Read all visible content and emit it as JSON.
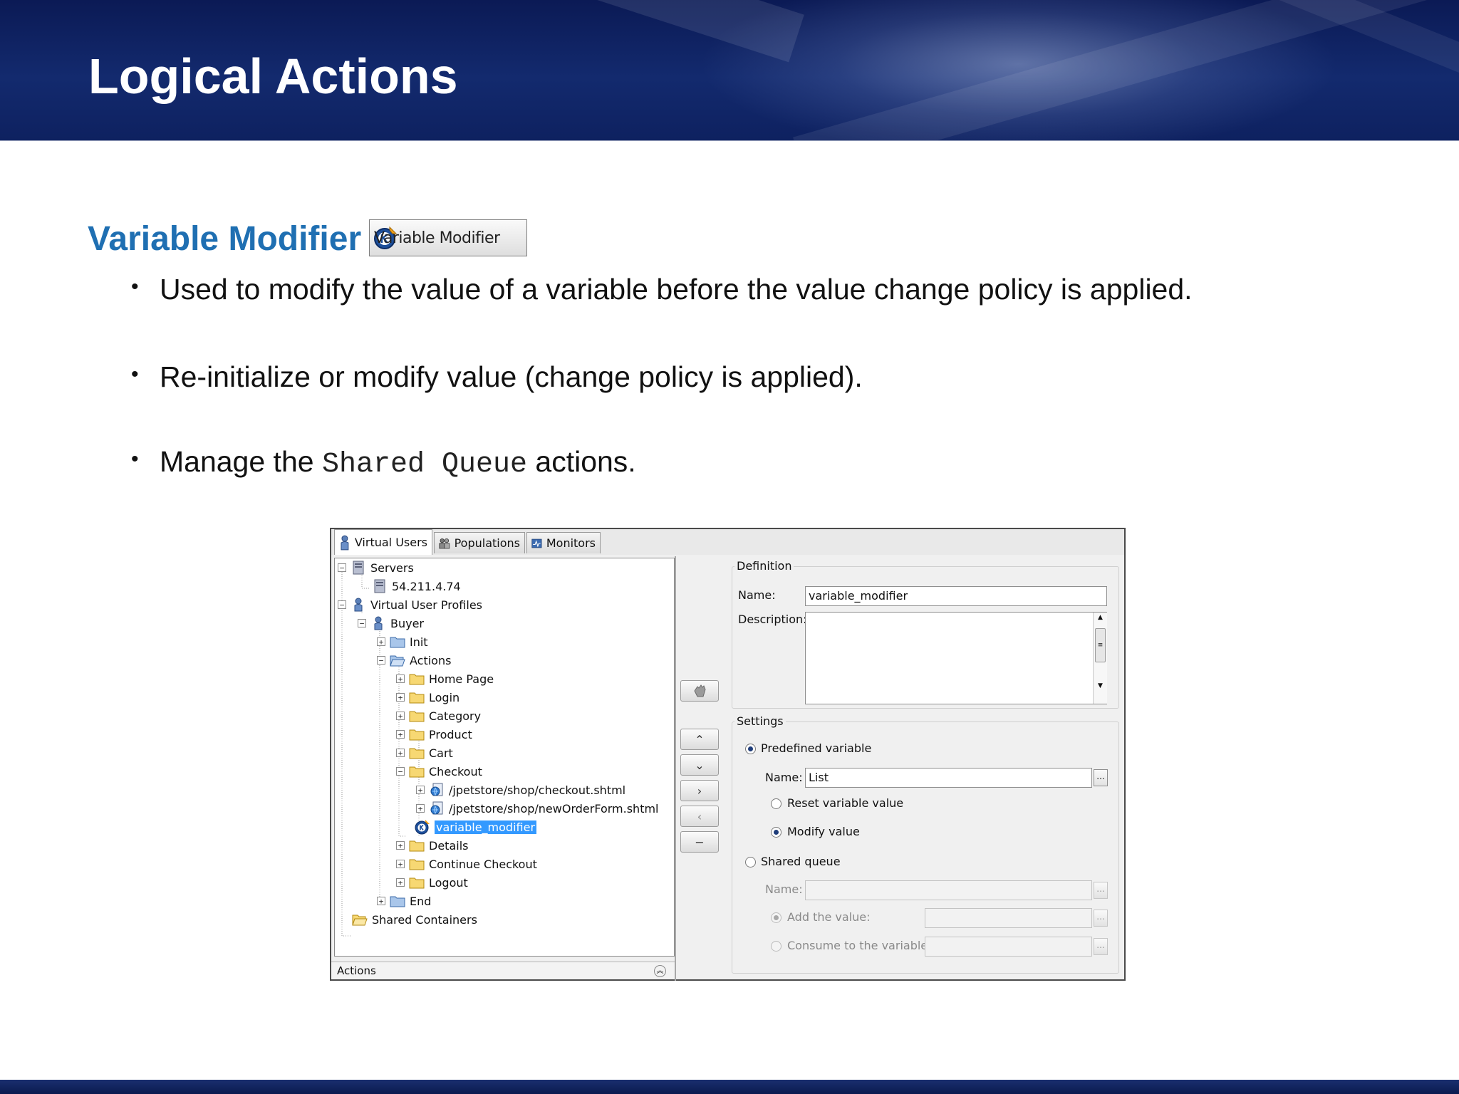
{
  "slide": {
    "title": "Logical Actions",
    "section_heading": "Variable Modifier",
    "button_label": "Variable Modifier",
    "bullets": [
      {
        "text": "Used to modify the value of a variable before the value change policy is applied."
      },
      {
        "text": "Re-initialize or modify value (change policy is applied)."
      },
      {
        "text_before": "Manage the ",
        "code": "Shared Queue",
        "text_after": " actions."
      }
    ]
  },
  "app": {
    "tabs": [
      {
        "label": "Virtual Users",
        "icon": "user-icon",
        "active": true
      },
      {
        "label": "Populations",
        "icon": "group-icon",
        "active": false
      },
      {
        "label": "Monitors",
        "icon": "monitor-icon",
        "active": false
      }
    ],
    "tree": {
      "servers": "Servers",
      "server_ip": "54.211.4.74",
      "profiles": "Virtual User Profiles",
      "buyer": "Buyer",
      "init": "Init",
      "actions": "Actions",
      "home_page": "Home Page",
      "login": "Login",
      "category": "Category",
      "product": "Product",
      "cart": "Cart",
      "checkout": "Checkout",
      "checkout_page": "/jpetstore/shop/checkout.shtml",
      "new_order_page": "/jpetstore/shop/newOrderForm.shtml",
      "variable_modifier": "variable_modifier",
      "details": "Details",
      "continue_checkout": "Continue Checkout",
      "logout": "Logout",
      "end": "End",
      "shared_containers": "Shared Containers"
    },
    "status_label": "Actions",
    "definition": {
      "group_label": "Definition",
      "name_label": "Name:",
      "name_value": "variable_modifier",
      "description_label": "Description:",
      "description_value": ""
    },
    "settings": {
      "group_label": "Settings",
      "predefined_variable": "Predefined variable",
      "name_label": "Name:",
      "name_value": "List",
      "reset_value": "Reset variable value",
      "modify_value": "Modify value",
      "shared_queue": "Shared queue",
      "queue_name_label": "Name:",
      "add_value": "Add the value:",
      "consume_value": "Consume to the variable:",
      "browse_label": "..."
    },
    "selected_mode": "Predefined variable",
    "selected_action": "Modify value"
  },
  "colors": {
    "header_bg": "#0e2160",
    "heading": "#1f6fb2",
    "selection": "#3399ff"
  }
}
